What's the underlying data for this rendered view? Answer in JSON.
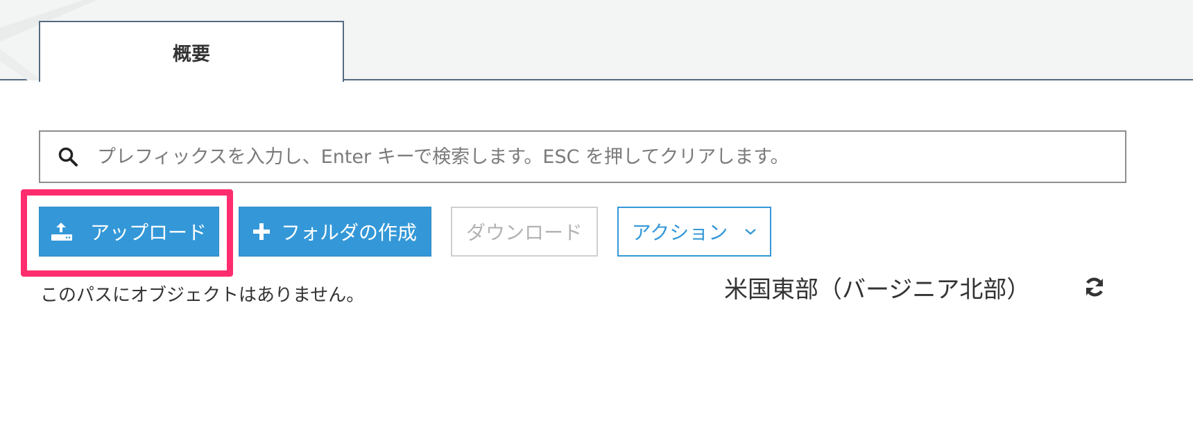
{
  "tabs": [
    {
      "label": "概要",
      "active": true
    }
  ],
  "search": {
    "placeholder": "プレフィックスを入力し、Enter キーで検索します。ESC を押してクリアします。",
    "value": ""
  },
  "toolbar": {
    "upload_label": "アップロード",
    "create_folder_label": "フォルダの作成",
    "download_label": "ダウンロード",
    "actions_label": "アクション"
  },
  "status": {
    "empty_message": "このパスにオブジェクトはありません。",
    "region": "米国東部（バージニア北部）"
  },
  "icons": {
    "search": "search-icon",
    "upload": "upload-icon",
    "plus": "plus-icon",
    "chevron": "chevron-down-icon",
    "refresh": "refresh-icon"
  },
  "colors": {
    "primary": "#3498d8",
    "highlight": "#ff2d6e",
    "tab_border": "#546b80"
  }
}
